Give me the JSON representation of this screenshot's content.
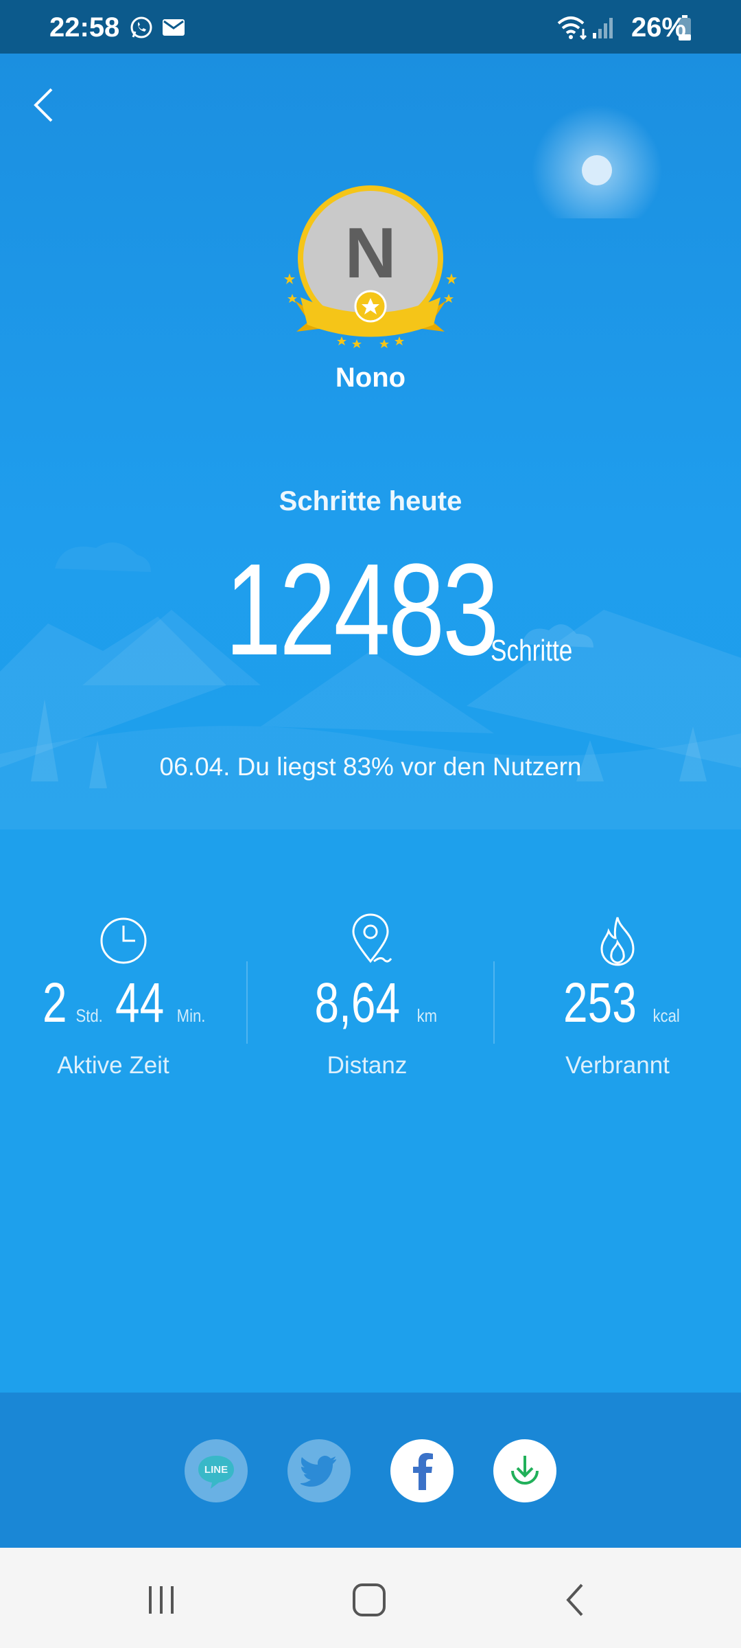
{
  "status_bar": {
    "time": "22:58",
    "battery": "26%"
  },
  "profile": {
    "avatar_initial": "N",
    "name": "Nono"
  },
  "steps": {
    "label": "Schritte heute",
    "value": "12483",
    "unit": "Schritte",
    "rank_text": "06.04. Du liegst 83% vor den Nutzern"
  },
  "stats": {
    "active_time": {
      "hours": "2",
      "hours_unit": "Std.",
      "minutes": "44",
      "minutes_unit": "Min.",
      "label": "Aktive Zeit"
    },
    "distance": {
      "value": "8,64",
      "unit": "km",
      "label": "Distanz"
    },
    "burned": {
      "value": "253",
      "unit": "kcal",
      "label": "Verbrannt"
    }
  },
  "share": {
    "line_label": "LINE"
  },
  "colors": {
    "primary": "#1ea0ec",
    "status_bar": "#0c5a8c",
    "share_bar": "#1a87d6",
    "badge": "#f5c518"
  }
}
